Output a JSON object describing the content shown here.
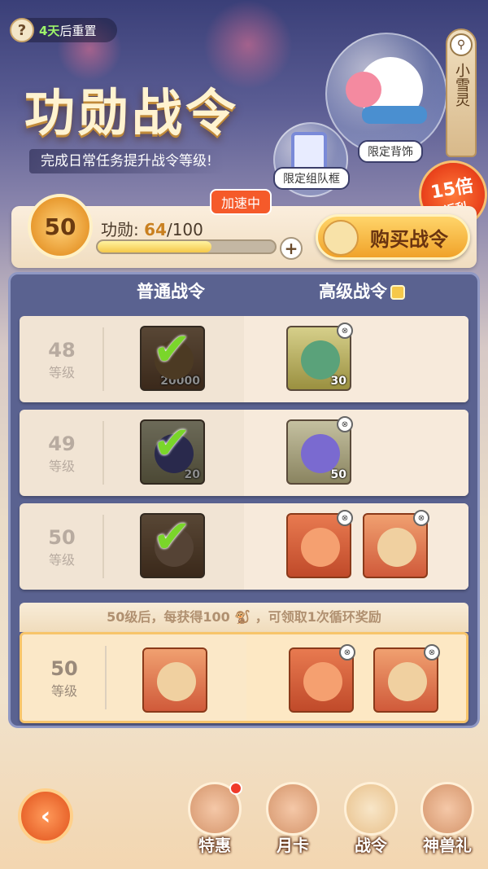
{
  "header": {
    "reset_days": "4天",
    "reset_suffix": "后重置",
    "title": "功勋战令",
    "subtitle": "完成日常任务提升战令等级!",
    "tag_back": "限定背饰",
    "tag_frame": "限定组队框",
    "side_tab": "小雪灵",
    "bonus_top": "15倍",
    "bonus_bottom": "返利"
  },
  "progress": {
    "level": "50",
    "speed_tag": "加速中",
    "merit_label": "功勋:",
    "merit_current": "64",
    "merit_total": "/100",
    "fraction": 0.64,
    "buy_label": "购买战令"
  },
  "columns": {
    "normal": "普通战令",
    "advanced": "高级战令"
  },
  "level_word": "等级",
  "rows": [
    {
      "level": "48",
      "normal_count": "20000",
      "adv1_count": "30"
    },
    {
      "level": "49",
      "normal_count": "20",
      "adv1_count": "50"
    },
    {
      "level": "50",
      "normal_count": "",
      "adv1_count": ""
    }
  ],
  "cycle": {
    "note": "50级后，每获得100 🐒 ，可领取1次循环奖励",
    "level": "50"
  },
  "nav": {
    "back": "‹",
    "items": [
      "特惠",
      "月卡",
      "战令",
      "神兽礼"
    ]
  },
  "colors": {
    "accent": "#f5c84a",
    "check": "#7ad62a",
    "speed": "#f55a2a"
  }
}
